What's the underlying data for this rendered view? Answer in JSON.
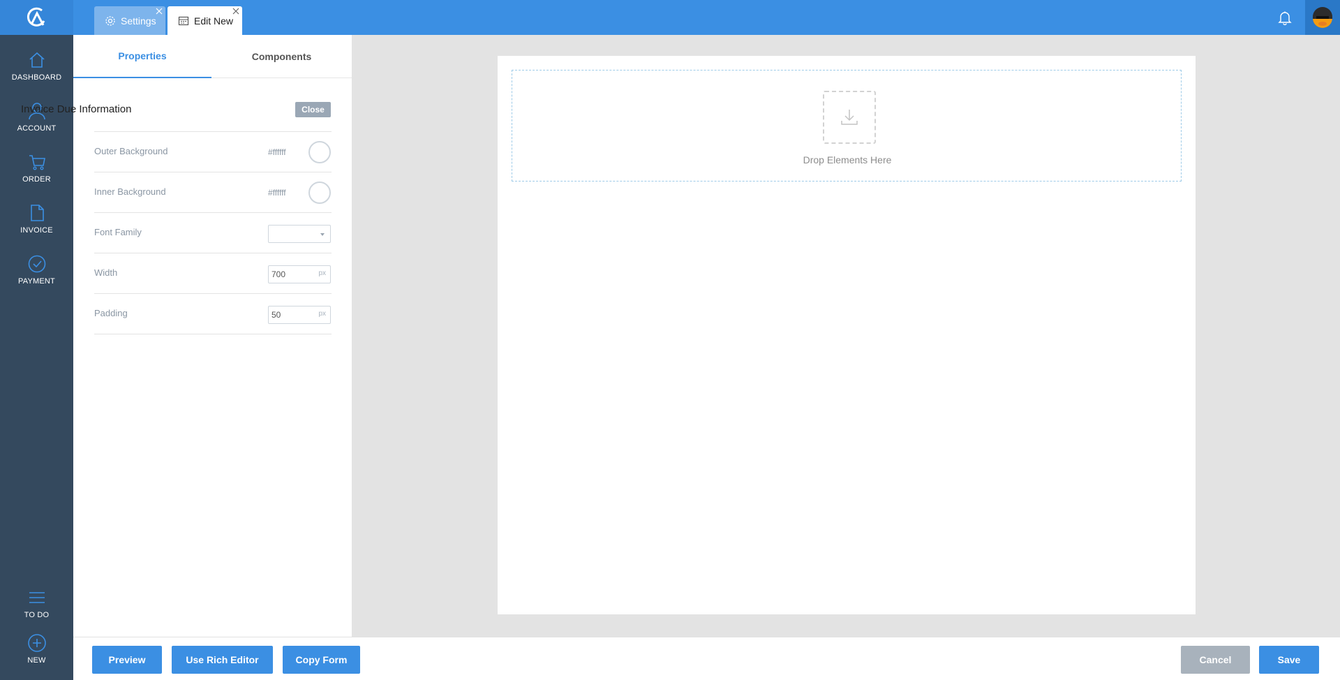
{
  "tabs": [
    {
      "label": "Settings",
      "icon": "gear-icon"
    },
    {
      "label": "Edit New",
      "icon": "calendar-icon"
    }
  ],
  "nav": {
    "items": [
      {
        "label": "DASHBOARD",
        "icon": "home-icon"
      },
      {
        "label": "ACCOUNT",
        "icon": "user-icon"
      },
      {
        "label": "ORDER",
        "icon": "cart-icon"
      },
      {
        "label": "INVOICE",
        "icon": "document-icon"
      },
      {
        "label": "PAYMENT",
        "icon": "check-circle-icon"
      }
    ],
    "bottom": [
      {
        "label": "TO DO",
        "icon": "list-icon"
      },
      {
        "label": "NEW",
        "icon": "plus-circle-icon"
      }
    ]
  },
  "panel": {
    "tabs": [
      "Properties",
      "Components"
    ],
    "active_tab": "Properties",
    "section_title": "Invoice Due Information",
    "close_label": "Close",
    "outer_background": {
      "label": "Outer Background",
      "value": "#ffffff"
    },
    "inner_background": {
      "label": "Inner Background",
      "value": "#ffffff"
    },
    "font_family": {
      "label": "Font Family",
      "value": ""
    },
    "width": {
      "label": "Width",
      "value": "700",
      "unit": "px"
    },
    "padding": {
      "label": "Padding",
      "value": "50",
      "unit": "px"
    }
  },
  "canvas": {
    "drop_text": "Drop Elements Here"
  },
  "footer": {
    "preview": "Preview",
    "rich_editor": "Use Rich Editor",
    "copy_form": "Copy Form",
    "cancel": "Cancel",
    "save": "Save"
  },
  "colors": {
    "primary": "#3b8fe3",
    "sidebar": "#34495e",
    "secondary_button": "#a8b2bc"
  }
}
